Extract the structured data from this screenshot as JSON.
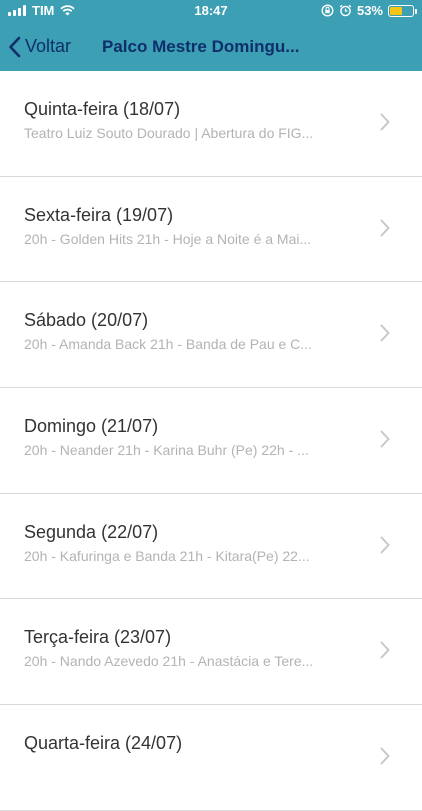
{
  "status": {
    "carrier": "TIM",
    "time": "18:47",
    "battery_percent": "53%",
    "battery_level": 0.53,
    "icons": [
      "signal-icon",
      "wifi-icon",
      "orientation-lock-icon",
      "alarm-icon",
      "battery-icon"
    ]
  },
  "nav": {
    "back_label": "Voltar",
    "title": "Palco Mestre Domingu..."
  },
  "days": [
    {
      "title": "Quinta-feira (18/07)",
      "subtitle": "Teatro Luiz Souto Dourado | Abertura do FIG..."
    },
    {
      "title": "Sexta-feira (19/07)",
      "subtitle": "20h - Golden Hits 21h - Hoje a Noite é a Mai..."
    },
    {
      "title": "Sábado (20/07)",
      "subtitle": "20h - Amanda Back 21h - Banda de Pau e C..."
    },
    {
      "title": "Domingo (21/07)",
      "subtitle": "20h - Neander 21h - Karina Buhr (Pe) 22h - ..."
    },
    {
      "title": "Segunda (22/07)",
      "subtitle": "20h - Kafuringa e Banda 21h - Kitara(Pe) 22..."
    },
    {
      "title": "Terça-feira (23/07)",
      "subtitle": "20h - Nando Azevedo 21h - Anastácia e Tere..."
    },
    {
      "title": "Quarta-feira (24/07)",
      "subtitle": ""
    }
  ],
  "colors": {
    "header_bg": "#3c9fb3",
    "header_text": "#0e2f6b",
    "title_text": "#333333",
    "subtitle_text": "#b3b3b3",
    "chevron": "#c7c7cc"
  }
}
